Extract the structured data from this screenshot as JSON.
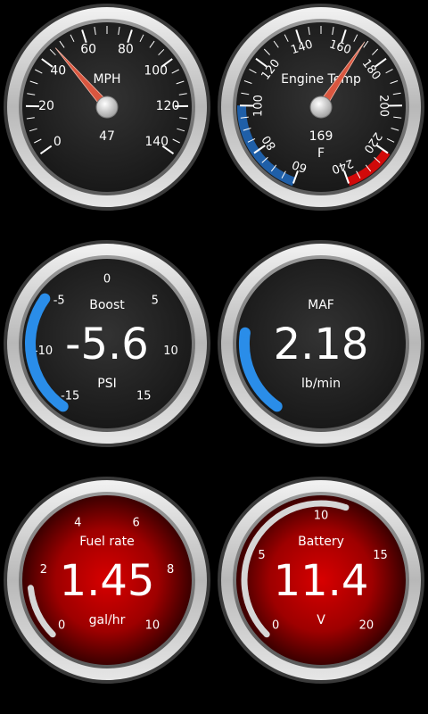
{
  "colors": {
    "dark_face": "#262626",
    "red_face": "#c40000",
    "accent_blue": "#2a8de9",
    "temp_blue": "#1f5fa8",
    "temp_red": "#d10a0a",
    "needle": "#d9563f",
    "text": "#ffffff"
  },
  "gauges": [
    {
      "id": "speed",
      "kind": "needle",
      "face": "dark",
      "title": "MPH",
      "unit": "",
      "value_text": "47",
      "value": 47,
      "min": 0,
      "max": 140,
      "ticks": [
        "0",
        "20",
        "40",
        "60",
        "80",
        "100",
        "120",
        "140"
      ]
    },
    {
      "id": "engine-temp",
      "kind": "needle",
      "face": "dark",
      "title": "Engine Temp",
      "unit": "F",
      "value_text": "169",
      "value": 169,
      "min": 60,
      "max": 240,
      "ticks": [
        "60",
        "80",
        "100",
        "120",
        "140",
        "160",
        "180",
        "200",
        "220",
        "240"
      ],
      "bands": [
        {
          "from": 60,
          "to": 100,
          "color": "#1f5fa8"
        },
        {
          "from": 220,
          "to": 240,
          "color": "#d10a0a"
        }
      ]
    },
    {
      "id": "boost",
      "kind": "digital",
      "face": "dark",
      "title": "Boost",
      "unit": "PSI",
      "value_text": "-5.6",
      "value": -5.6,
      "min": -15,
      "max": 15,
      "ticks": [
        "-15",
        "-10",
        "-5",
        "0",
        "5",
        "10",
        "15"
      ]
    },
    {
      "id": "maf",
      "kind": "digital",
      "face": "dark",
      "title": "MAF",
      "unit": "lb/min",
      "value_text": "2.18",
      "value": 2.18,
      "min": 0,
      "max": 10,
      "ticks": []
    },
    {
      "id": "fuel-rate",
      "kind": "digital",
      "face": "red",
      "title": "Fuel rate",
      "unit": "gal/hr",
      "value_text": "1.45",
      "value": 1.45,
      "min": 0,
      "max": 10,
      "ticks": [
        "0",
        "2",
        "4",
        "6",
        "8",
        "10"
      ]
    },
    {
      "id": "battery",
      "kind": "digital",
      "face": "red",
      "title": "Battery",
      "unit": "V",
      "value_text": "11.4",
      "value": 11.4,
      "min": 0,
      "max": 20,
      "ticks": [
        "0",
        "5",
        "10",
        "15",
        "20"
      ]
    }
  ]
}
